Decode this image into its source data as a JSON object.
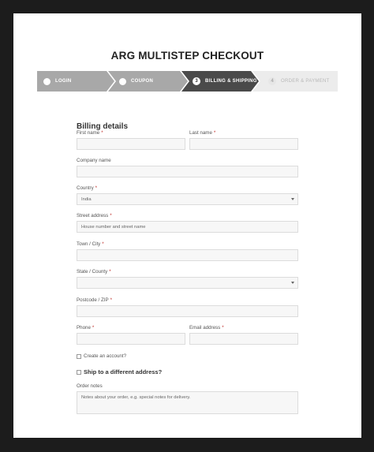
{
  "page": {
    "title": "ARG MULTISTEP CHECKOUT"
  },
  "steps": [
    {
      "label": "LOGIN",
      "state": "done",
      "marker": "check"
    },
    {
      "label": "COUPON",
      "state": "done",
      "marker": "check"
    },
    {
      "label": "BILLING & SHIPPING",
      "state": "current",
      "marker": "3"
    },
    {
      "label": "ORDER & PAYMENT",
      "state": "upcoming",
      "marker": "4"
    }
  ],
  "billing": {
    "title": "Billing details",
    "first_name": {
      "label": "First name",
      "value": ""
    },
    "last_name": {
      "label": "Last name",
      "value": ""
    },
    "company": {
      "label": "Company name",
      "value": ""
    },
    "country": {
      "label": "Country",
      "value": "India"
    },
    "street": {
      "label": "Street address",
      "placeholder": "House number and street name"
    },
    "city": {
      "label": "Town / City",
      "value": ""
    },
    "state": {
      "label": "State / County",
      "value": ""
    },
    "postcode": {
      "label": "Postcode / ZIP",
      "value": ""
    },
    "phone": {
      "label": "Phone",
      "value": ""
    },
    "email": {
      "label": "Email address",
      "value": ""
    },
    "required_mark": "*"
  },
  "create_account": {
    "label": "Create an account?"
  },
  "ship_different": {
    "label": "Ship to a different address?"
  },
  "order_notes": {
    "label": "Order notes",
    "placeholder": "Notes about your order, e.g. special notes for delivery."
  },
  "colors": {
    "step_done": "#a8a8a8",
    "step_current": "#4a4a4a",
    "step_upcoming": "#ececec",
    "required": "#c0302b"
  }
}
